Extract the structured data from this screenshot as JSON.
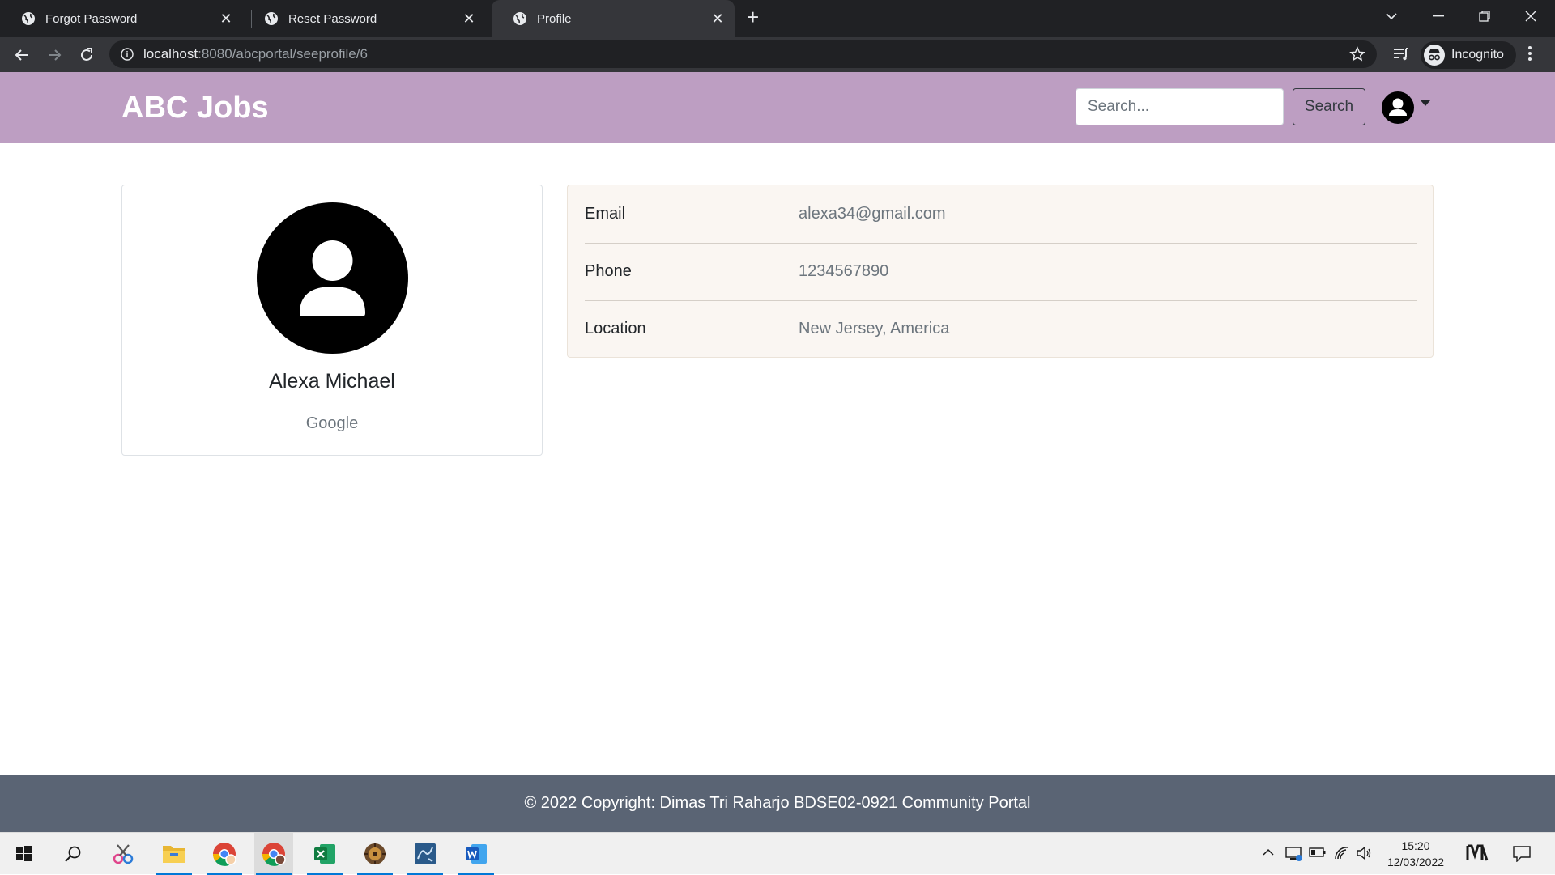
{
  "browser": {
    "tabs": [
      {
        "title": "Forgot Password",
        "active": false
      },
      {
        "title": "Reset Password",
        "active": false
      },
      {
        "title": "Profile",
        "active": true
      }
    ],
    "url": {
      "host": "localhost",
      "rest": ":8080/abcportal/seeprofile/6"
    },
    "profile_label": "Incognito",
    "icons": [
      "back-icon",
      "forward-icon",
      "reload-icon",
      "info-icon",
      "star-icon",
      "reading-list-icon",
      "incognito-icon",
      "kebab-menu-icon",
      "tab-search-icon",
      "minimize-icon",
      "restore-icon",
      "close-icon"
    ]
  },
  "navbar": {
    "brand": "ABC Jobs",
    "search_placeholder": "Search...",
    "search_label": "Search",
    "bg_color": "#bd9ec2"
  },
  "profile": {
    "name": "Alexa Michael",
    "company": "Google",
    "details": [
      {
        "label": "Email",
        "value": "alexa34@gmail.com"
      },
      {
        "label": "Phone",
        "value": "1234567890"
      },
      {
        "label": "Location",
        "value": "New Jersey, America"
      }
    ]
  },
  "footer": {
    "text": "© 2022 Copyright: Dimas Tri Raharjo BDSE02-0921 Community Portal",
    "bg_color": "#5a6474"
  },
  "taskbar": {
    "apps": [
      "start-icon",
      "search-icon",
      "snipping-tool-icon",
      "file-explorer-icon",
      "chrome-profile-icon",
      "chrome-icon",
      "excel-icon",
      "game-app-icon",
      "mysql-workbench-icon",
      "word-icon"
    ],
    "time": "15:20",
    "date": "12/03/2022"
  }
}
